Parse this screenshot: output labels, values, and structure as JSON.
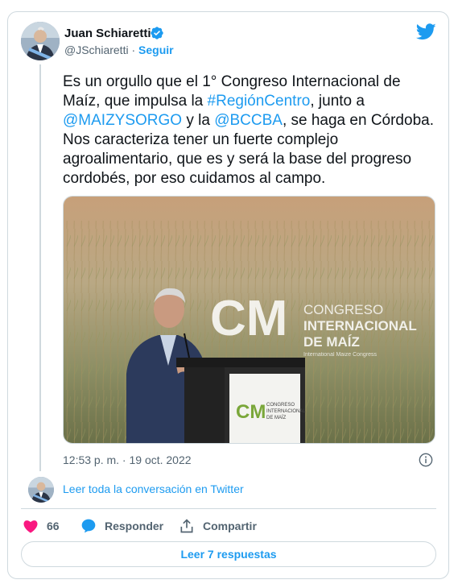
{
  "author": {
    "name": "Juan Schiaretti",
    "handle": "@JSchiaretti",
    "separator": "·",
    "follow_label": "Seguir",
    "verified_icon": "verified-badge-icon"
  },
  "tweet": {
    "text_parts": [
      "Es un orgullo que el 1° Congreso Internacional de Maíz, que impulsa la ",
      "#RegiónCentro",
      ", junto a ",
      "@MAIZYSORGO",
      " y la ",
      "@BCCBA",
      ", se haga en Córdoba. Nos caracteriza tener un fuerte complejo agroalimentario, que es y será la base del progreso cordobés, por eso cuidamos al campo."
    ],
    "timestamp": "12:53 p. m. · 19 oct. 2022"
  },
  "photo": {
    "logo_letters": "CM",
    "logo_line1": "CONGRESO",
    "logo_line2": "INTERNACIONAL",
    "logo_line3": "DE MAÍZ",
    "logo_sub": "International Maize Congress",
    "podium_line1": "CONGRESO",
    "podium_line2": "INTERNACIONAL",
    "podium_line3": "DE MAÍZ"
  },
  "conversation_link": "Leer toda la conversación en Twitter",
  "actions": {
    "like_count": "66",
    "reply_label": "Responder",
    "share_label": "Compartir"
  },
  "read_replies_label": "Leer 7 respuestas",
  "colors": {
    "accent": "#1d9bf0",
    "like": "#f91880",
    "secondary_text": "#536471",
    "border": "#cfd9de"
  }
}
